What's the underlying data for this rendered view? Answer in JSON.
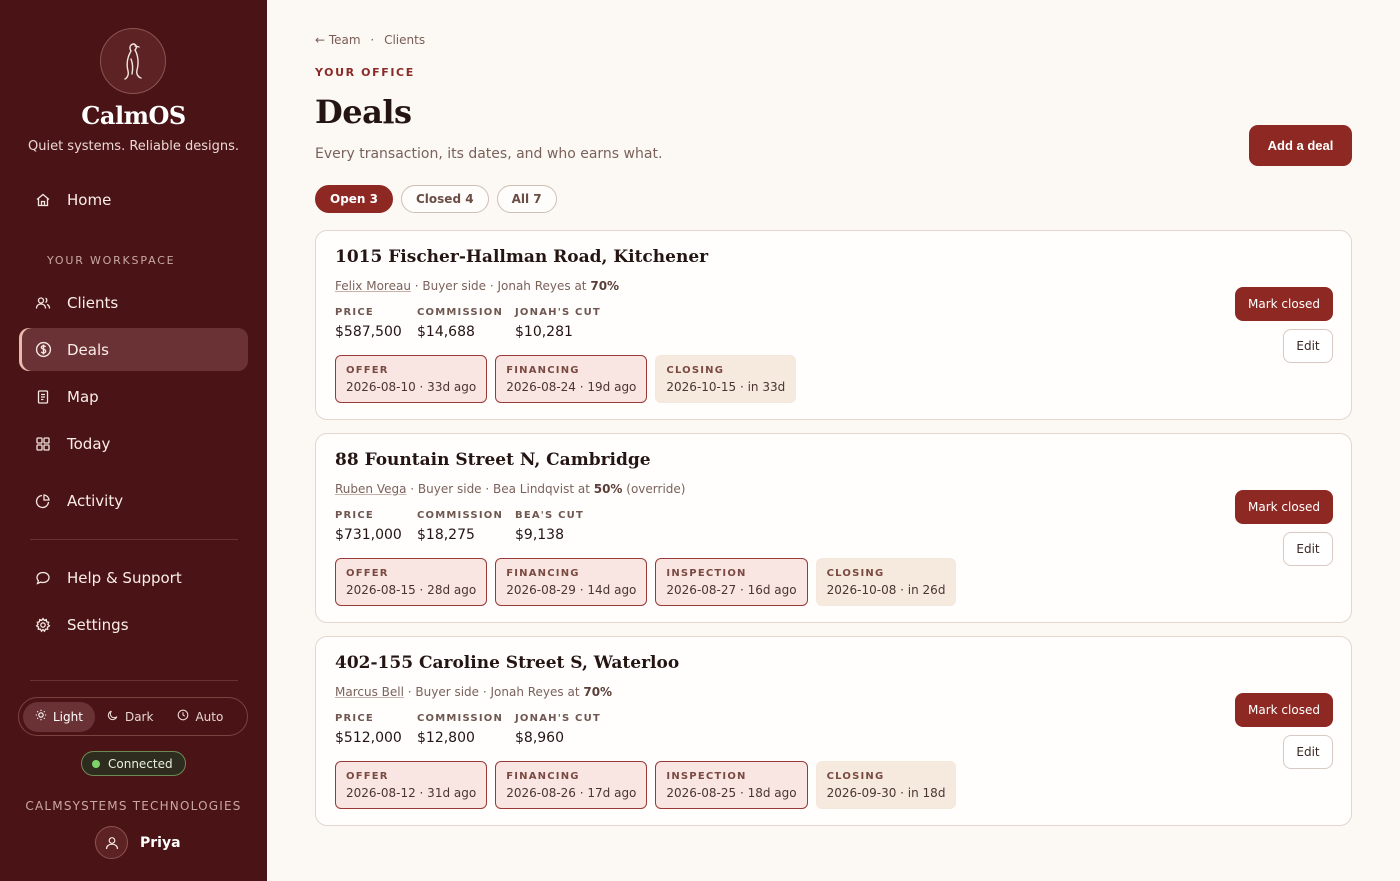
{
  "sidebar": {
    "brand": "CalmOS",
    "tagline": "Quiet systems. Reliable designs.",
    "section_label": "YOUR WORKSPACE",
    "items": [
      {
        "label": "Home",
        "icon": "home-icon"
      },
      {
        "label": "Clients",
        "icon": "users-icon"
      },
      {
        "label": "Deals",
        "icon": "dollar-icon"
      },
      {
        "label": "Map",
        "icon": "document-icon"
      },
      {
        "label": "Today",
        "icon": "grid-icon"
      },
      {
        "label": "Activity",
        "icon": "chart-icon"
      },
      {
        "label": "Help & Support",
        "icon": "chat-icon"
      },
      {
        "label": "Settings",
        "icon": "gear-icon"
      }
    ],
    "theme": {
      "light": "Light",
      "dark": "Dark",
      "auto": "Auto"
    },
    "status": "Connected",
    "company": "CALMSYSTEMS TECHNOLOGIES",
    "user": "Priya"
  },
  "header": {
    "back": "← Team",
    "sep": "·",
    "crumb": "Clients",
    "eyebrow": "YOUR OFFICE",
    "title": "Deals",
    "subtitle": "Every transaction, its dates, and who earns what.",
    "add_label": "Add a deal"
  },
  "filters": [
    {
      "label": "Open 3"
    },
    {
      "label": "Closed 4"
    },
    {
      "label": "All 7"
    }
  ],
  "labels": {
    "price": "PRICE",
    "commission": "COMMISSION",
    "mark_closed": "Mark closed",
    "edit": "Edit"
  },
  "deals": [
    {
      "address": "1015 Fischer-Hallman Road, Kitchener",
      "client": "Felix Moreau",
      "side": " · Buyer side · Jonah Reyes at ",
      "pct": "70%",
      "note": "",
      "price": "$587,500",
      "commission": "$14,688",
      "cut_label": "JONAH'S CUT",
      "cut": "$10,281",
      "milestones": [
        {
          "label": "OFFER",
          "date": "2026-08-10 · 33d ago"
        },
        {
          "label": "FINANCING",
          "date": "2026-08-24 · 19d ago"
        },
        {
          "label": "CLOSING",
          "date": "2026-10-15 · in 33d"
        }
      ]
    },
    {
      "address": "88 Fountain Street N, Cambridge",
      "client": "Ruben Vega",
      "side": " · Buyer side · Bea Lindqvist at ",
      "pct": "50%",
      "note": " (override)",
      "price": "$731,000",
      "commission": "$18,275",
      "cut_label": "BEA'S CUT",
      "cut": "$9,138",
      "milestones": [
        {
          "label": "OFFER",
          "date": "2026-08-15 · 28d ago"
        },
        {
          "label": "FINANCING",
          "date": "2026-08-29 · 14d ago"
        },
        {
          "label": "INSPECTION",
          "date": "2026-08-27 · 16d ago"
        },
        {
          "label": "CLOSING",
          "date": "2026-10-08 · in 26d"
        }
      ]
    },
    {
      "address": "402-155 Caroline Street S, Waterloo",
      "client": "Marcus Bell",
      "side": " · Buyer side · Jonah Reyes at ",
      "pct": "70%",
      "note": "",
      "price": "$512,000",
      "commission": "$12,800",
      "cut_label": "JONAH'S CUT",
      "cut": "$8,960",
      "milestones": [
        {
          "label": "OFFER",
          "date": "2026-08-12 · 31d ago"
        },
        {
          "label": "FINANCING",
          "date": "2026-08-26 · 17d ago"
        },
        {
          "label": "INSPECTION",
          "date": "2026-08-25 · 18d ago"
        },
        {
          "label": "CLOSING",
          "date": "2026-09-30 · in 18d"
        }
      ]
    }
  ]
}
